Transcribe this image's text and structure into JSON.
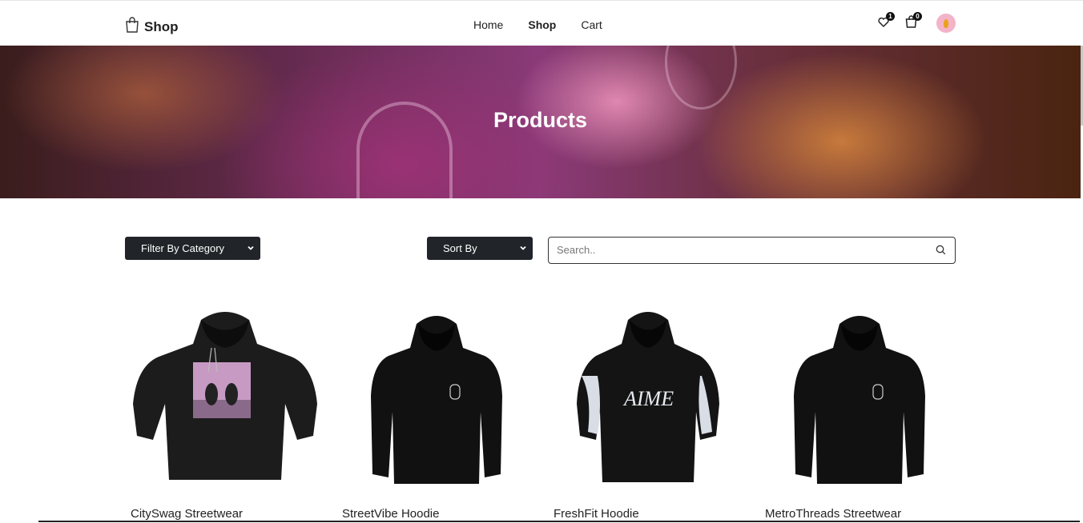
{
  "brand": {
    "name": "Shop",
    "icon": "shopping-bag-icon"
  },
  "nav": {
    "links": [
      {
        "label": "Home",
        "active": false
      },
      {
        "label": "Shop",
        "active": true
      },
      {
        "label": "Cart",
        "active": false
      }
    ],
    "wishlist_count": "1",
    "cart_count": "0"
  },
  "hero": {
    "title": "Products"
  },
  "filters": {
    "category_label": "Filter By Category",
    "sort_label": "Sort By",
    "search_placeholder": "Search.."
  },
  "products": [
    {
      "name": "CitySwag Streetwear",
      "variant": "photo-print-hoodie"
    },
    {
      "name": "StreetVibe Hoodie",
      "variant": "plain-logo-hoodie"
    },
    {
      "name": "FreshFit Hoodie",
      "variant": "aime-print-hoodie"
    },
    {
      "name": "MetroThreads Streetwear",
      "variant": "plain-logo-hoodie"
    }
  ],
  "colors": {
    "accent": "#212529",
    "text": "#222222",
    "badge": "#111111"
  }
}
